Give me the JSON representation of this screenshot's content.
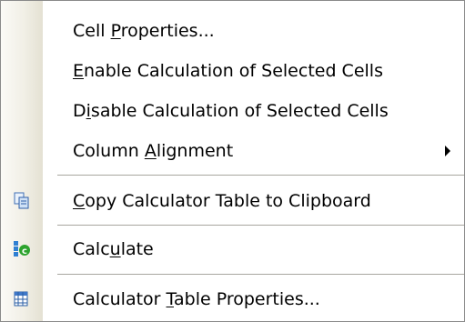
{
  "menu": {
    "items": [
      {
        "pre": "Cell ",
        "key": "P",
        "post": "roperties..."
      },
      {
        "pre": "",
        "key": "E",
        "post": "nable Calculation of Selected Cells"
      },
      {
        "pre": "D",
        "key": "i",
        "post": "sable Calculation of Selected Cells"
      },
      {
        "pre": "Column ",
        "key": "A",
        "post": "lignment"
      },
      {
        "pre": "",
        "key": "C",
        "post": "opy Calculator Table to Clipboard",
        "icon": "copy-icon"
      },
      {
        "pre": "Calc",
        "key": "u",
        "post": "late",
        "icon": "calculate-icon"
      },
      {
        "pre": "Calculator ",
        "key": "T",
        "post": "able Properties...",
        "icon": "table-properties-icon"
      }
    ],
    "submenu_icon": "submenu-arrow-icon"
  }
}
